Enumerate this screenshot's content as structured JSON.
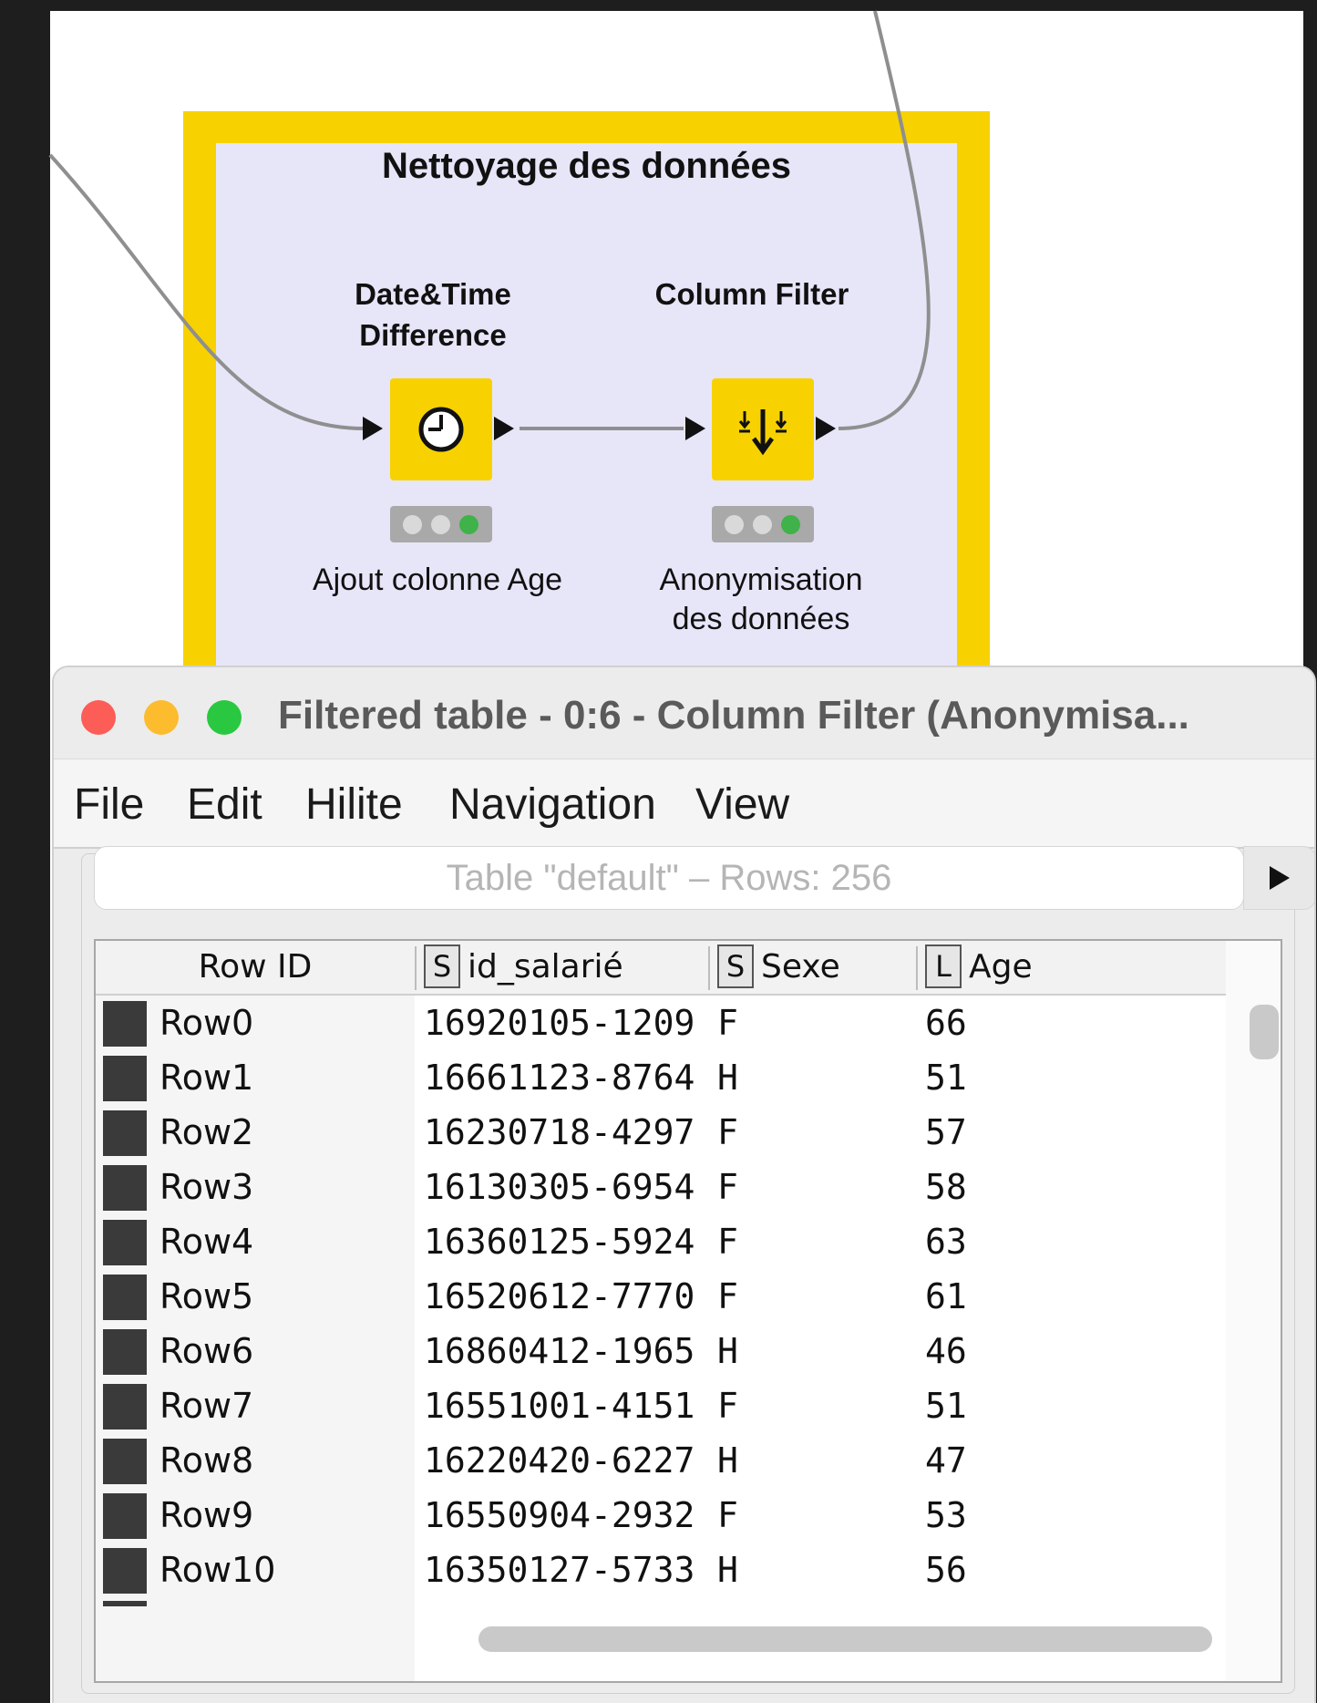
{
  "workflow": {
    "annotation_title": "Nettoyage des données",
    "nodes": [
      {
        "name_line1": "Date&Time",
        "name_line2": "Difference",
        "icon": "clock-icon",
        "status": "executed",
        "label_line1": "Ajout colonne Age",
        "label_line2": ""
      },
      {
        "name_line1": "",
        "name_line2": "Column Filter",
        "icon": "column-filter-icon",
        "status": "executed",
        "label_line1": "Anonymisation",
        "label_line2": "des données"
      }
    ],
    "colors": {
      "annotation_border": "#f7d200",
      "annotation_fill": "#e7e6f9",
      "node_fill": "#f7d200",
      "status_green": "#3fb24a"
    }
  },
  "table_window": {
    "title": "Filtered table - 0:6 - Column Filter (Anonymisa...",
    "menu": [
      "File",
      "Edit",
      "Hilite",
      "Navigation",
      "View"
    ],
    "table_name": "Table \"default\" – Rows: 256",
    "columns": [
      {
        "label": "Row ID",
        "type": ""
      },
      {
        "label": "id_salarié",
        "type": "S"
      },
      {
        "label": "Sexe",
        "type": "S"
      },
      {
        "label": "Age",
        "type": "L"
      }
    ],
    "rows": [
      {
        "id": "Row0",
        "id_salarie": "16920105-1209",
        "sexe": "F",
        "age": "66"
      },
      {
        "id": "Row1",
        "id_salarie": "16661123-8764",
        "sexe": "H",
        "age": "51"
      },
      {
        "id": "Row2",
        "id_salarie": "16230718-4297",
        "sexe": "F",
        "age": "57"
      },
      {
        "id": "Row3",
        "id_salarie": "16130305-6954",
        "sexe": "F",
        "age": "58"
      },
      {
        "id": "Row4",
        "id_salarie": "16360125-5924",
        "sexe": "F",
        "age": "63"
      },
      {
        "id": "Row5",
        "id_salarie": "16520612-7770",
        "sexe": "F",
        "age": "61"
      },
      {
        "id": "Row6",
        "id_salarie": "16860412-1965",
        "sexe": "H",
        "age": "46"
      },
      {
        "id": "Row7",
        "id_salarie": "16551001-4151",
        "sexe": "F",
        "age": "51"
      },
      {
        "id": "Row8",
        "id_salarie": "16220420-6227",
        "sexe": "H",
        "age": "47"
      },
      {
        "id": "Row9",
        "id_salarie": "16550904-2932",
        "sexe": "F",
        "age": "53"
      },
      {
        "id": "Row10",
        "id_salarie": "16350127-5733",
        "sexe": "H",
        "age": "56"
      }
    ]
  }
}
